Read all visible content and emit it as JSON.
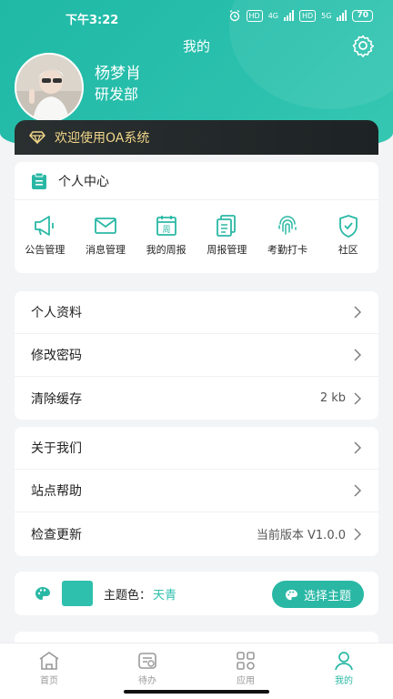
{
  "status_bar": {
    "time": "下午3:22",
    "battery": "70",
    "net1": "4G",
    "net2": "5G",
    "hd": "HD"
  },
  "header": {
    "title": "我的"
  },
  "user": {
    "name": "杨梦肖",
    "department": "研发部"
  },
  "welcome": {
    "text": "欢迎使用OA系统"
  },
  "personal_center": {
    "title": "个人中心",
    "items": [
      {
        "label": "公告管理",
        "icon": "megaphone-icon"
      },
      {
        "label": "消息管理",
        "icon": "mail-icon"
      },
      {
        "label": "我的周报",
        "icon": "calendar-week-icon"
      },
      {
        "label": "周报管理",
        "icon": "documents-icon"
      },
      {
        "label": "考勤打卡",
        "icon": "fingerprint-icon"
      },
      {
        "label": "社区",
        "icon": "shield-check-icon"
      }
    ]
  },
  "settings_group1": [
    {
      "label": "个人资料",
      "value": ""
    },
    {
      "label": "修改密码",
      "value": ""
    },
    {
      "label": "清除缓存",
      "value": "2 kb"
    }
  ],
  "settings_group2": [
    {
      "label": "关于我们",
      "value": ""
    },
    {
      "label": "站点帮助",
      "value": ""
    },
    {
      "label": "检查更新",
      "value": "当前版本 V1.0.0"
    }
  ],
  "theme": {
    "label": "主题色：",
    "value": "天青",
    "button": "选择主题",
    "color": "#2ec0ac"
  },
  "tabbar": [
    {
      "label": "首页",
      "icon": "home-icon",
      "active": false
    },
    {
      "label": "待办",
      "icon": "todo-icon",
      "active": false
    },
    {
      "label": "应用",
      "icon": "apps-icon",
      "active": false
    },
    {
      "label": "我的",
      "icon": "user-icon",
      "active": true
    }
  ],
  "colors": {
    "accent": "#2ab8a5",
    "gold": "#f1d689"
  }
}
